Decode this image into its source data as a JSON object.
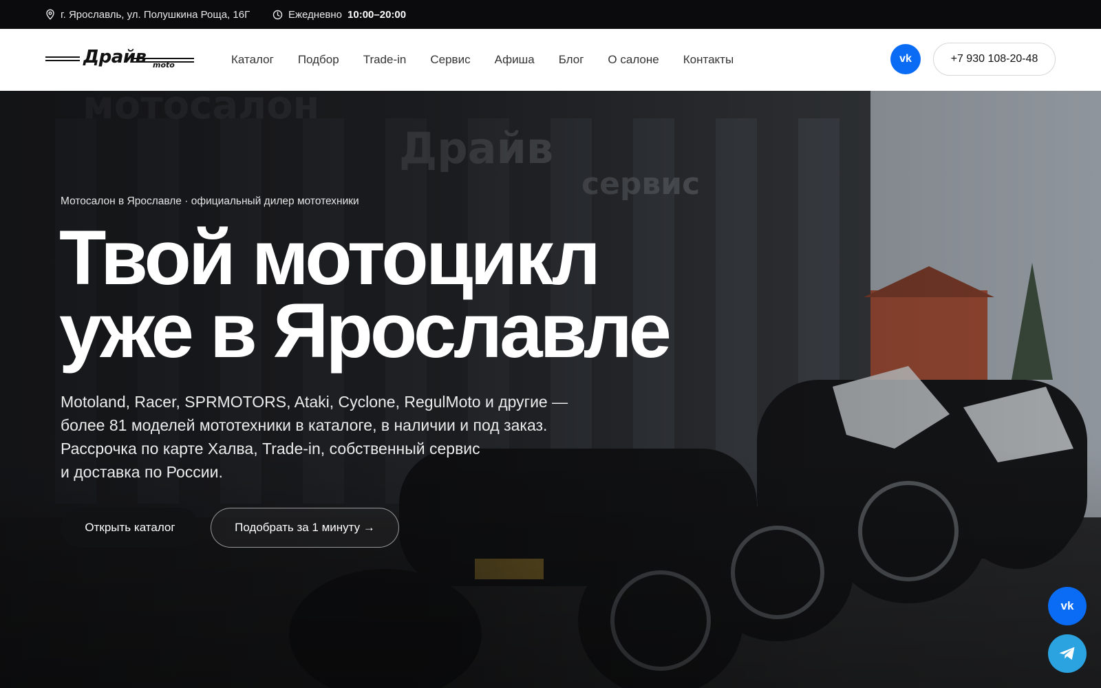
{
  "topbar": {
    "address": "г. Ярославль, ул. Полушкина Роща, 16Г",
    "hours_prefix": "Ежедневно",
    "hours_value": "10:00–20:00",
    "address_icon": "location-pin-icon",
    "hours_icon": "clock-icon"
  },
  "header": {
    "logo_word": "Драйв",
    "logo_sub": "moto",
    "nav": [
      {
        "label": "Каталог"
      },
      {
        "label": "Подбор"
      },
      {
        "label": "Trade-in"
      },
      {
        "label": "Сервис"
      },
      {
        "label": "Афиша"
      },
      {
        "label": "Блог"
      },
      {
        "label": "О салоне"
      },
      {
        "label": "Контакты"
      }
    ],
    "vk_label": "vk",
    "phone": "+7 930 108-20-48"
  },
  "hero": {
    "eyebrow": "Мотосалон в Ярославле · официальный дилер мототехники",
    "title_line1": "Твой мотоцикл",
    "title_line2": "уже в Ярославле",
    "lead_line1": "Motoland, Racer, SPRMOTORS, Ataki, Cyclone, RegulMoto и другие —",
    "lead_line2": "более 81 моделей мототехники в каталоге, в наличии и под заказ.",
    "lead_line3": "Рассрочка по карте Халва, Trade-in, собственный сервис",
    "lead_line4": "и доставка по России.",
    "primary_cta": "Открыть каталог",
    "secondary_cta": "Подобрать за 1 минуту →"
  },
  "floating": {
    "vk_label": "vk",
    "telegram_icon": "telegram-icon"
  },
  "colors": {
    "topbar_bg": "#0b0b0d",
    "vk_blue": "#0a6cf5",
    "telegram_blue": "#2aa3e0"
  }
}
